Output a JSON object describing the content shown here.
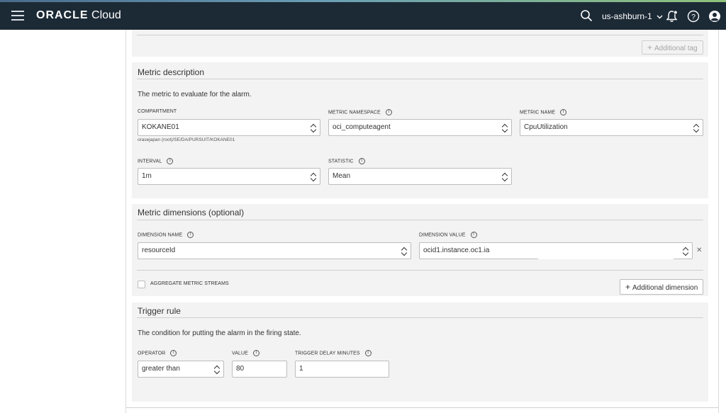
{
  "header": {
    "brand": "ORACLE",
    "product": "Cloud",
    "region": "us-ashburn-1"
  },
  "icons": {
    "menu": "hamburger-icon",
    "search": "search-icon",
    "notifications": "bell-icon",
    "help": "help-icon",
    "profile": "user-icon"
  },
  "tags": {
    "additional_tag_button": "Additional tag"
  },
  "metric_description": {
    "title": "Metric description",
    "description": "The metric to evaluate for the alarm.",
    "compartment_label": "COMPARTMENT",
    "compartment_value": "KOKANE01",
    "compartment_path": "orasejapan (root)/SE/DA/PURSUIT/KOKANE01",
    "namespace_label": "METRIC NAMESPACE",
    "namespace_value": "oci_computeagent",
    "metric_name_label": "METRIC NAME",
    "metric_name_value": "CpuUtilization",
    "interval_label": "INTERVAL",
    "interval_value": "1m",
    "statistic_label": "STATISTIC",
    "statistic_value": "Mean"
  },
  "metric_dimensions": {
    "title": "Metric dimensions (optional)",
    "dimension_name_label": "DIMENSION NAME",
    "dimension_name_value": "resourceId",
    "dimension_value_label": "DIMENSION VALUE",
    "dimension_value_value": "ocid1.instance.oc1.ia",
    "aggregate_label": "AGGREGATE METRIC STREAMS",
    "additional_dimension_button": "Additional dimension"
  },
  "trigger_rule": {
    "title": "Trigger rule",
    "description": "The condition for putting the alarm in the firing state.",
    "operator_label": "OPERATOR",
    "operator_value": "greater than",
    "value_label": "VALUE",
    "value_value": "80",
    "delay_label": "TRIGGER DELAY MINUTES",
    "delay_value": "1"
  }
}
